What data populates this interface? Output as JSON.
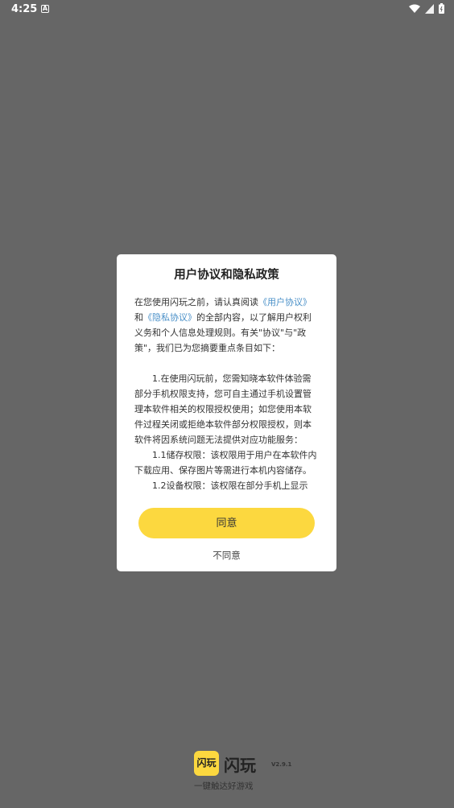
{
  "status_bar": {
    "time": "4:25",
    "notification_icon": "a-icon",
    "icons": [
      "wifi-icon",
      "signal-icon",
      "battery-icon"
    ]
  },
  "dialog": {
    "title": "用户协议和隐私政策",
    "intro_prefix": "在您使用闪玩之前，请认真阅读",
    "user_agreement_link": "《用户协议》",
    "and_text": "和",
    "privacy_link": "《隐私协议》",
    "intro_suffix": "的全部内容，以了解用户权利义务和个人信息处理规则。有关\"协议\"与\"政策\"，我们已为您摘要重点条目如下：",
    "paragraph_1": "1.在使用闪玩前，您需知晓本软件体验需部分手机权限支持，您可自主通过手机设置管理本软件相关的权限授权使用；如您使用本软件过程关闭或拒绝本软件部分权限授权，则本软件将因系统问题无法提供对应功能服务：",
    "paragraph_1_1": "1.1储存权限：该权限用于用户在本软件内下载应用、保存图片等需进行本机内容储存。",
    "paragraph_1_2": "1.2设备权限：该权限在部分手机上显示",
    "agree_label": "同意",
    "disagree_label": "不同意"
  },
  "brand": {
    "logo_text": "闪玩",
    "name": "闪玩",
    "version": "V2.9.1",
    "slogan": "一键触达好游戏"
  },
  "colors": {
    "accent": "#fcd83f",
    "link": "#4a90c8",
    "overlay": "#666666"
  }
}
